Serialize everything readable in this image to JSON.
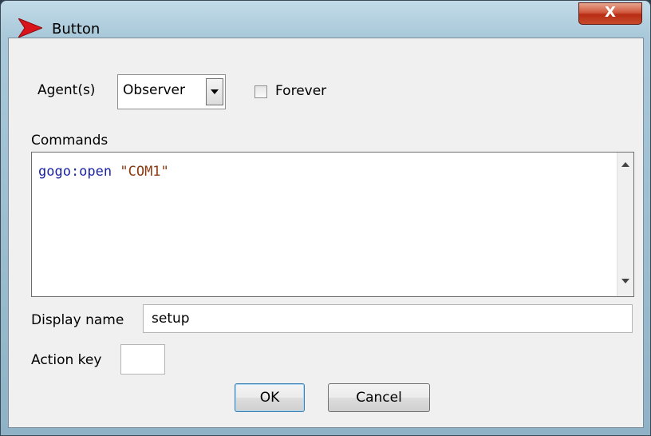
{
  "window": {
    "title": "Button",
    "close_glyph": "X",
    "icon": "red-arrow-icon"
  },
  "form": {
    "agents_label": "Agent(s)",
    "agents_selected": "Observer",
    "forever_label": "Forever",
    "forever_checked": false,
    "commands_label": "Commands",
    "commands_code": {
      "command": "gogo:open ",
      "argument": "\"COM1\""
    },
    "display_name_label": "Display name",
    "display_name_value": "setup",
    "action_key_label": "Action key",
    "action_key_value": ""
  },
  "buttons": {
    "ok": "OK",
    "cancel": "Cancel"
  },
  "colors": {
    "code_command": "#1a24a4",
    "code_string": "#8b3a12",
    "close_button": "#c74a2a",
    "focus_border": "#3c7fb1"
  }
}
